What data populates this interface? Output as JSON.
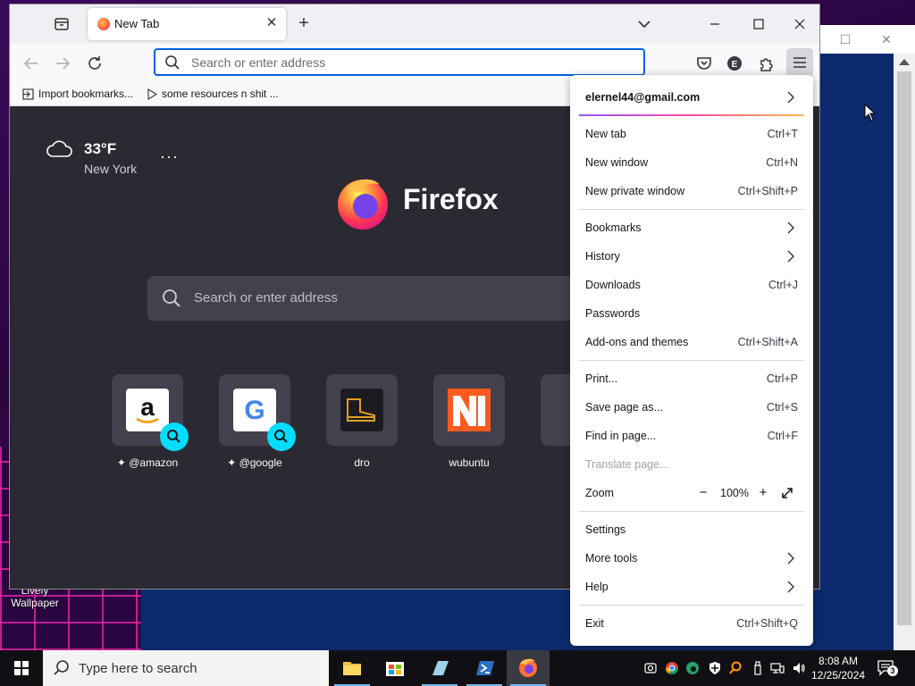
{
  "browser": {
    "tab_title": "New Tab",
    "url_placeholder": "Search or enter address",
    "bookmarks": [
      "Import bookmarks...",
      "some resources n shit ..."
    ]
  },
  "newtab": {
    "weather_temp": "33°F",
    "weather_city": "New York",
    "brand": "Firefox",
    "search_placeholder": "Search or enter address",
    "shortcuts": [
      {
        "label": "@amazon"
      },
      {
        "label": "@google"
      },
      {
        "label": "dro"
      },
      {
        "label": "wubuntu"
      }
    ]
  },
  "menu": {
    "account": "elernel44@gmail.com",
    "items": [
      {
        "label": "New tab",
        "shortcut": "Ctrl+T"
      },
      {
        "label": "New window",
        "shortcut": "Ctrl+N"
      },
      {
        "label": "New private window",
        "shortcut": "Ctrl+Shift+P"
      },
      {
        "label": "Bookmarks",
        "shortcut": ""
      },
      {
        "label": "History",
        "shortcut": ""
      },
      {
        "label": "Downloads",
        "shortcut": "Ctrl+J"
      },
      {
        "label": "Passwords",
        "shortcut": ""
      },
      {
        "label": "Add-ons and themes",
        "shortcut": "Ctrl+Shift+A"
      },
      {
        "label": "Print...",
        "shortcut": "Ctrl+P"
      },
      {
        "label": "Save page as...",
        "shortcut": "Ctrl+S"
      },
      {
        "label": "Find in page...",
        "shortcut": "Ctrl+F"
      },
      {
        "label": "Translate page...",
        "shortcut": ""
      },
      {
        "label": "Zoom",
        "shortcut": ""
      },
      {
        "label": "Settings",
        "shortcut": ""
      },
      {
        "label": "More tools",
        "shortcut": ""
      },
      {
        "label": "Help",
        "shortcut": ""
      },
      {
        "label": "Exit",
        "shortcut": "Ctrl+Shift+Q"
      }
    ],
    "zoom_value": "100%",
    "zoom_minus": "−",
    "zoom_plus": "+"
  },
  "desktop": {
    "icon_label": "Lively Wallpaper"
  },
  "taskbar": {
    "search_placeholder": "Type here to search",
    "time": "8:08 AM",
    "date": "12/25/2024",
    "notification_count": "3"
  },
  "colors": {
    "accent": "#0061e0",
    "newtab_bg": "#2b2a33",
    "search_badge": "#00ddff"
  }
}
